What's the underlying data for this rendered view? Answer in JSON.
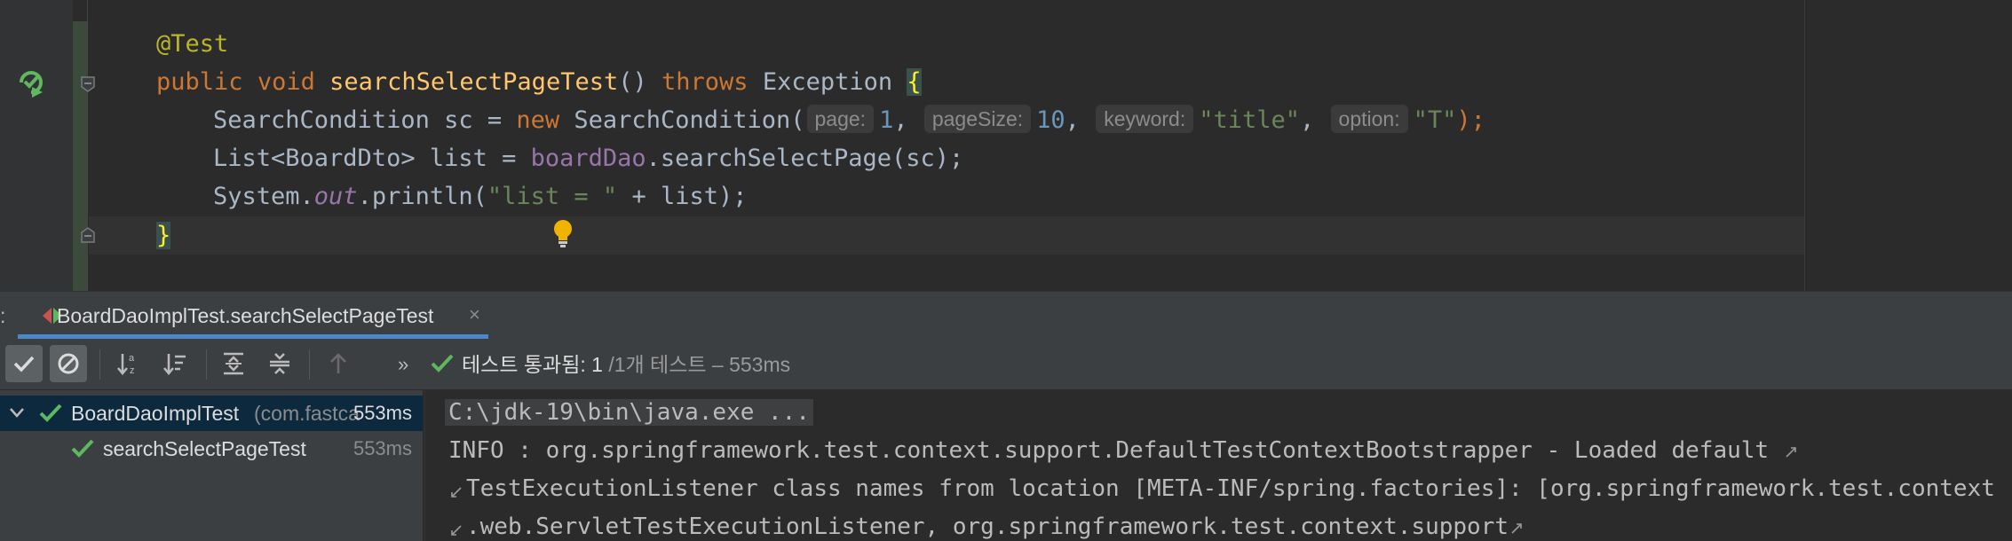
{
  "editor": {
    "lines": {
      "annotation": "@Test",
      "sig_public": "public",
      "sig_void": "void",
      "sig_name": "searchSelectPageTest",
      "sig_parens": "()",
      "sig_throws": "throws",
      "sig_exception": "Exception",
      "sig_brace": "{",
      "l3_type": "SearchCondition sc = ",
      "l3_new": "new",
      "l3_ctor": " SearchCondition(",
      "l3_hint_page": "page:",
      "l3_val_page": "1",
      "l3_comma1": ", ",
      "l3_hint_pagesize": "pageSize:",
      "l3_val_pagesize": "10",
      "l3_comma2": ", ",
      "l3_hint_keyword": "keyword:",
      "l3_val_keyword": "\"title\"",
      "l3_comma3": ", ",
      "l3_hint_option": "option:",
      "l3_val_option": "\"T\"",
      "l3_end": ");",
      "l4_decl": "List<BoardDto> list = ",
      "l4_field": "boardDao",
      "l4_call": ".searchSelectPage(sc);",
      "l5_system": "System.",
      "l5_out": "out",
      "l5_println": ".println(",
      "l5_str": "\"list = \"",
      "l5_rest": " + list);",
      "close_brace": "}"
    }
  },
  "run_panel": {
    "tab_prefix": ":",
    "tab_label": "BoardDaoImplTest.searchSelectPageTest",
    "tab_close": "×",
    "toolbar": {
      "overflow": "»",
      "status_main": "테스트 통과됨: 1 ",
      "status_of": "/1개 테스트 – 553ms"
    },
    "tree": {
      "root_name": "BoardDaoImplTest",
      "root_pkg": "(com.fastca",
      "root_time": "553ms",
      "child_name": "searchSelectPageTest",
      "child_time": "553ms"
    },
    "console": {
      "line1": "C:\\jdk-19\\bin\\java.exe ...",
      "line2": "INFO : org.springframework.test.context.support.DefaultTestContextBootstrapper - Loaded default ",
      "line3": "TestExecutionListener class names from location [META-INF/spring.factories]: [org.springframework.test.context",
      "line4": ".web.ServletTestExecutionListener, org.springframework.test.context.support"
    }
  },
  "colors": {
    "keyword": "#cc7832",
    "method": "#ffc66d",
    "string": "#6a8759",
    "number": "#6897bb",
    "annotation": "#bbb529",
    "pass_green": "#5fb85f",
    "selection": "#0d293e"
  },
  "icons": {
    "gutter_run": "run-test-passed-icon",
    "fold": "fold-icon",
    "bulb": "intention-bulb-icon",
    "tab": "test-run-icon",
    "toolbar": [
      "show-passed-icon",
      "show-ignored-icon",
      "sort-alpha-icon",
      "sort-duration-icon",
      "expand-all-icon",
      "collapse-all-icon",
      "previous-failed-icon"
    ],
    "status": "check-icon",
    "tree": [
      "expand-arrow-icon",
      "check-icon"
    ],
    "soft_wrap": "soft-wrap-icon"
  }
}
